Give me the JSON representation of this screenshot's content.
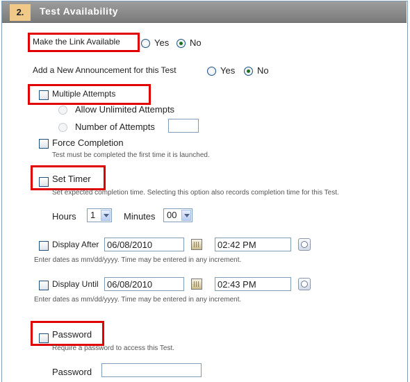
{
  "section": {
    "number": "2.",
    "title": "Test Availability"
  },
  "link_available": {
    "label": "Make the Link Available",
    "yes": "Yes",
    "no": "No",
    "selected": "No"
  },
  "announcement": {
    "label": "Add a New Announcement for this Test",
    "yes": "Yes",
    "no": "No",
    "selected": "No"
  },
  "multiple_attempts": {
    "label": "Multiple Attempts",
    "unlimited": "Allow Unlimited Attempts",
    "number": "Number of Attempts",
    "number_value": ""
  },
  "force_completion": {
    "label": "Force Completion",
    "help": "Test must be completed the first time it is launched."
  },
  "timer": {
    "label": "Set Timer",
    "help": "Set expected completion time. Selecting this option also records completion time for this Test.",
    "hours_label": "Hours",
    "hours_value": "1",
    "minutes_label": "Minutes",
    "minutes_value": "00"
  },
  "display_after": {
    "label": "Display After",
    "date": "06/08/2010",
    "time": "02:42 PM",
    "help": "Enter dates as mm/dd/yyyy. Time may be entered in any increment."
  },
  "display_until": {
    "label": "Display Until",
    "date": "06/08/2010",
    "time": "02:43 PM",
    "help": "Enter dates as mm/dd/yyyy. Time may be entered in any increment."
  },
  "password": {
    "label": "Password",
    "help": "Require a password to access this Test.",
    "field_label": "Password",
    "value": ""
  },
  "icons": {
    "calendar": "calendar-icon",
    "clock": "clock-icon"
  },
  "colors": {
    "header": "#8c8c8c",
    "step_badge": "#f0c888",
    "highlight": "#e00000"
  }
}
